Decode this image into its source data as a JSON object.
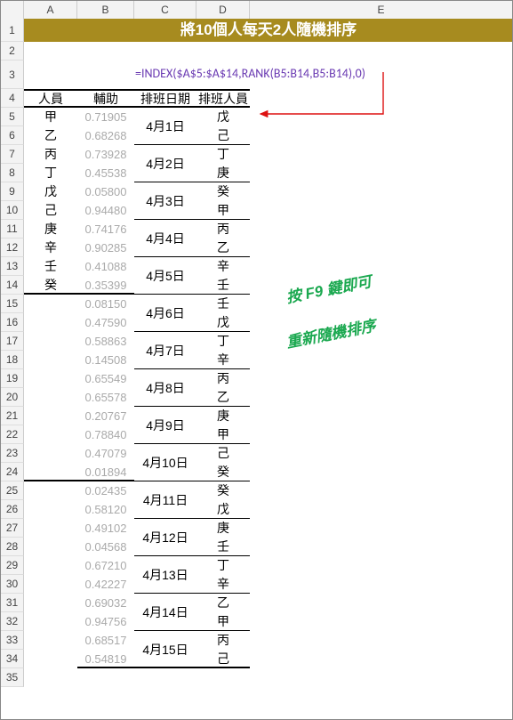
{
  "title": "將10個人每天2人隨機排序",
  "formula": "=INDEX($A$5:$A$14,RANK(B5:B14,B5:B14),0)",
  "columns": [
    "A",
    "B",
    "C",
    "D",
    "E"
  ],
  "headers": {
    "a": "人員",
    "b": "輔助",
    "c": "排班日期",
    "d": "排班人員"
  },
  "note_line1": "按 F9 鍵即可",
  "note_line2": "重新隨機排序",
  "people": [
    "甲",
    "乙",
    "丙",
    "丁",
    "戊",
    "己",
    "庚",
    "辛",
    "壬",
    "癸"
  ],
  "aux": [
    "0.71905",
    "0.68268",
    "0.73928",
    "0.45538",
    "0.05800",
    "0.94480",
    "0.74176",
    "0.90285",
    "0.41088",
    "0.35399",
    "0.08150",
    "0.47590",
    "0.58863",
    "0.14508",
    "0.65549",
    "0.65578",
    "0.20767",
    "0.78840",
    "0.47079",
    "0.01894",
    "0.02435",
    "0.58120",
    "0.49102",
    "0.04568",
    "0.67210",
    "0.42227",
    "0.69032",
    "0.94756",
    "0.68517",
    "0.54819"
  ],
  "dates": [
    "4月1日",
    "4月2日",
    "4月3日",
    "4月4日",
    "4月5日",
    "4月6日",
    "4月7日",
    "4月8日",
    "4月9日",
    "4月10日",
    "4月11日",
    "4月12日",
    "4月13日",
    "4月14日",
    "4月15日"
  ],
  "schedule": [
    "戊",
    "己",
    "丁",
    "庚",
    "癸",
    "甲",
    "丙",
    "乙",
    "辛",
    "壬",
    "壬",
    "戊",
    "丁",
    "辛",
    "丙",
    "乙",
    "庚",
    "甲",
    "己",
    "癸",
    "癸",
    "戊",
    "庚",
    "壬",
    "丁",
    "辛",
    "乙",
    "甲",
    "丙",
    "己"
  ],
  "chart_data": {
    "type": "table",
    "title": "將10個人每天2人隨機排序",
    "columns": [
      "人員",
      "輔助",
      "排班日期",
      "排班人員"
    ],
    "rows": [
      [
        "甲",
        "0.71905",
        "4月1日",
        "戊"
      ],
      [
        "乙",
        "0.68268",
        "",
        "己"
      ],
      [
        "丙",
        "0.73928",
        "4月2日",
        "丁"
      ],
      [
        "丁",
        "0.45538",
        "",
        "庚"
      ],
      [
        "戊",
        "0.05800",
        "4月3日",
        "癸"
      ],
      [
        "己",
        "0.94480",
        "",
        "甲"
      ],
      [
        "庚",
        "0.74176",
        "4月4日",
        "丙"
      ],
      [
        "辛",
        "0.90285",
        "",
        "乙"
      ],
      [
        "壬",
        "0.41088",
        "4月5日",
        "辛"
      ],
      [
        "癸",
        "0.35399",
        "",
        "壬"
      ],
      [
        "",
        "0.08150",
        "4月6日",
        "壬"
      ],
      [
        "",
        "0.47590",
        "",
        "戊"
      ],
      [
        "",
        "0.58863",
        "4月7日",
        "丁"
      ],
      [
        "",
        "0.14508",
        "",
        "辛"
      ],
      [
        "",
        "0.65549",
        "4月8日",
        "丙"
      ],
      [
        "",
        "0.65578",
        "",
        "乙"
      ],
      [
        "",
        "0.20767",
        "4月9日",
        "庚"
      ],
      [
        "",
        "0.78840",
        "",
        "甲"
      ],
      [
        "",
        "0.47079",
        "4月10日",
        "己"
      ],
      [
        "",
        "0.01894",
        "",
        "癸"
      ],
      [
        "",
        "0.02435",
        "4月11日",
        "癸"
      ],
      [
        "",
        "0.58120",
        "",
        "戊"
      ],
      [
        "",
        "0.49102",
        "4月12日",
        "庚"
      ],
      [
        "",
        "0.04568",
        "",
        "壬"
      ],
      [
        "",
        "0.67210",
        "4月13日",
        "丁"
      ],
      [
        "",
        "0.42227",
        "",
        "辛"
      ],
      [
        "",
        "0.69032",
        "4月14日",
        "乙"
      ],
      [
        "",
        "0.94756",
        "",
        "甲"
      ],
      [
        "",
        "0.68517",
        "4月15日",
        "丙"
      ],
      [
        "",
        "0.54819",
        "",
        "己"
      ]
    ]
  }
}
